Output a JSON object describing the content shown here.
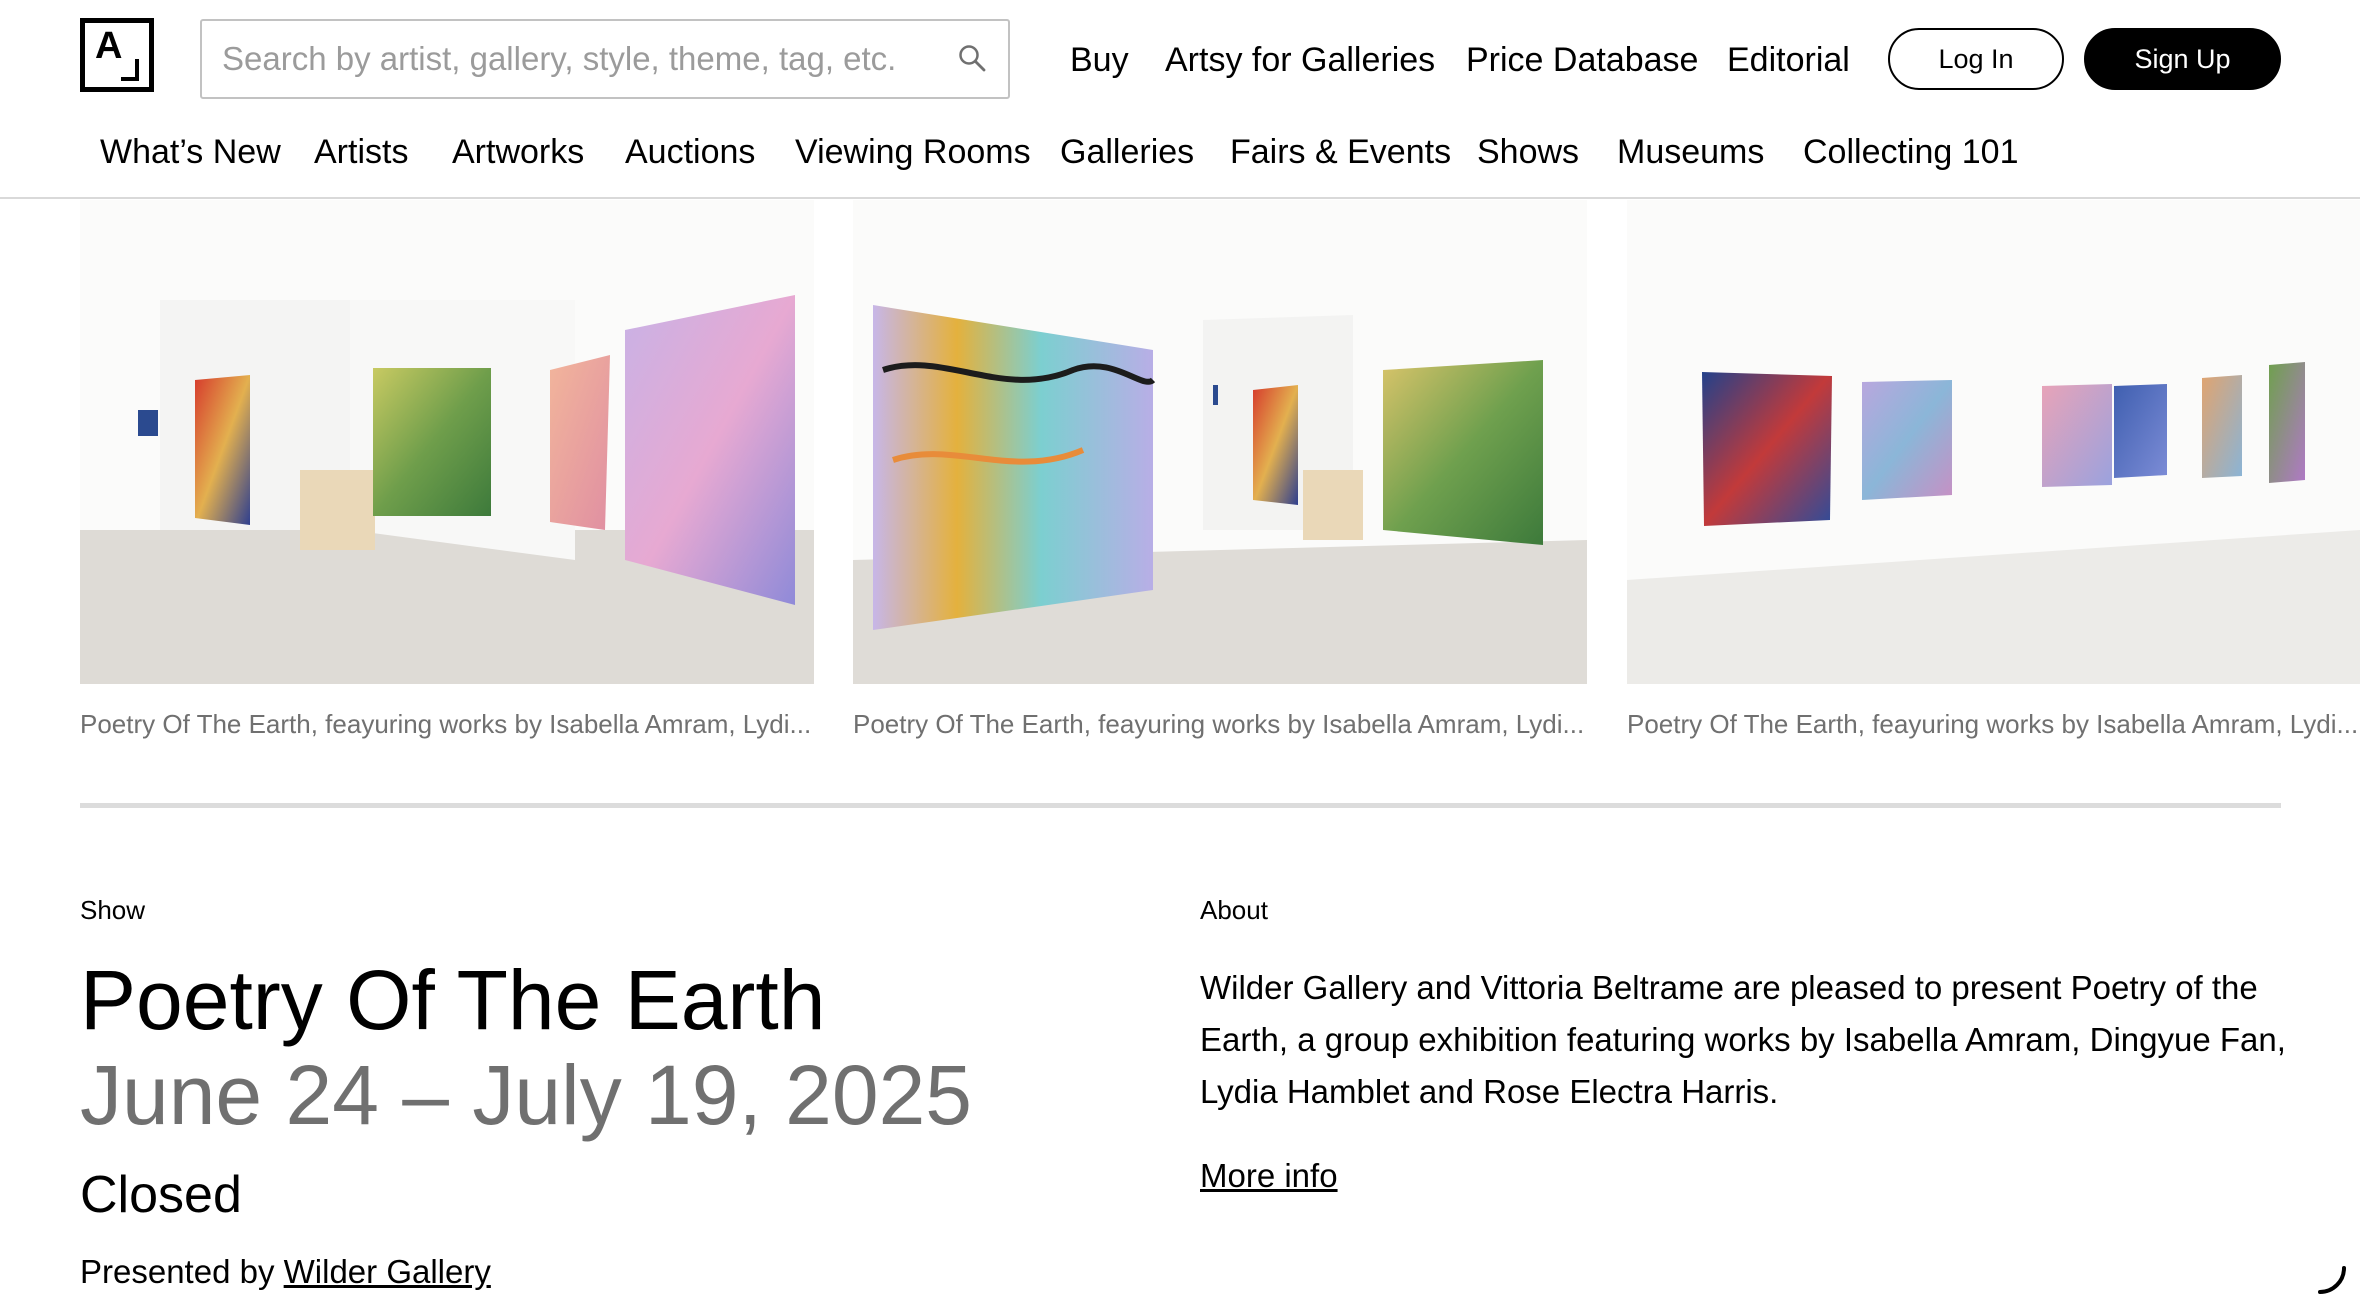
{
  "header": {
    "logo_letter": "A",
    "search": {
      "placeholder": "Search by artist, gallery, style, theme, tag, etc.",
      "value": ""
    },
    "top_nav": [
      "Buy",
      "Artsy for Galleries",
      "Price Database",
      "Editorial"
    ],
    "login_label": "Log In",
    "signup_label": "Sign Up",
    "sub_nav": [
      "What’s New",
      "Artists",
      "Artworks",
      "Auctions",
      "Viewing Rooms",
      "Galleries",
      "Fairs & Events",
      "Shows",
      "Museums",
      "Collecting 101"
    ]
  },
  "gallery": {
    "images": [
      {
        "caption": "Poetry Of The Earth, feayuring works by Isabella Amram, Lydi..."
      },
      {
        "caption": "Poetry Of The Earth, feayuring works by Isabella Amram, Lydi..."
      },
      {
        "caption": "Poetry Of The Earth, feayuring works by Isabella Amram, Lydi..."
      }
    ]
  },
  "show": {
    "label": "Show",
    "title": "Poetry Of The Earth",
    "dates": "June 24 – July 19, 2025",
    "status": "Closed",
    "presented_by_prefix": "Presented by",
    "presented_by_link": "Wilder Gallery"
  },
  "about": {
    "label": "About",
    "text": "Wilder Gallery and Vittoria Beltrame are pleased to present Poetry of the Earth, a group exhibition featuring works by Isabella Amram, Dingyue Fan, Lydia Hamblet and Rose Electra Harris.",
    "more_info": "More info"
  },
  "colors": {
    "accent": "#000000",
    "muted_text": "#707070",
    "rule": "#d9d9d9",
    "progress_track": "#dcdcdc"
  }
}
